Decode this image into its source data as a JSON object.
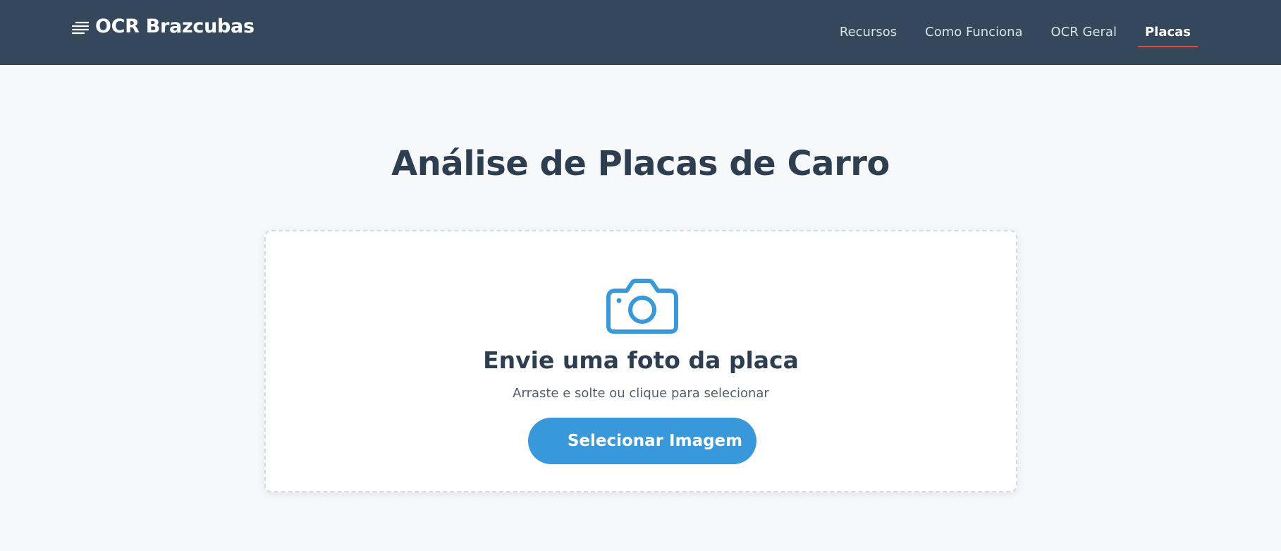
{
  "header": {
    "brand": "OCR Brazcubas",
    "brand_icon": "text-lines-icon",
    "nav": [
      {
        "label": "Recursos",
        "active": false
      },
      {
        "label": "Como Funciona",
        "active": false
      },
      {
        "label": "OCR Geral",
        "active": false
      },
      {
        "label": "Placas",
        "active": true
      }
    ]
  },
  "main": {
    "title": "Análise de Placas de Carro",
    "upload": {
      "icon": "camera-icon",
      "heading": "Envie uma foto da placa",
      "subtitle": "Arraste e solte ou clique para selecionar",
      "button_label": "Selecionar Imagem"
    }
  },
  "colors": {
    "navbar": "#35485b",
    "accent": "#3898d9",
    "active_underline": "#e74c3c",
    "background": "#f7f8fa"
  }
}
